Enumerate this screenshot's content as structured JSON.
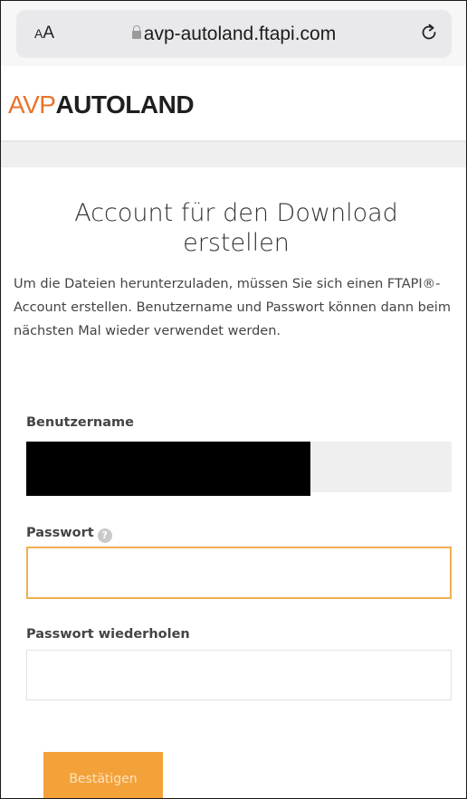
{
  "browser": {
    "aa_label": "AA",
    "url": "avp-autoland.ftapi.com",
    "lock_icon": "lock-icon",
    "reload_icon": "reload-icon"
  },
  "brand": {
    "logo_part1": "AVP",
    "logo_part2": "AUTOLAND",
    "accent_color": "#e8732a"
  },
  "form": {
    "title": "Account für den Download erstellen",
    "intro": "Um die Dateien herunterzuladen, müssen Sie sich einen FTAPI®-Account erstellen. Benutzername und Passwort können dann beim nächsten Mal wieder verwendet werden.",
    "username_label": "Benutzername",
    "username_value": "",
    "password_label": "Passwort",
    "password_value": "",
    "help_icon": "question-circle-icon",
    "password_repeat_label": "Passwort wiederholen",
    "password_repeat_value": "",
    "submit_label": "Bestätigen",
    "button_color": "#f3a23a",
    "focus_color": "#f0b050"
  }
}
